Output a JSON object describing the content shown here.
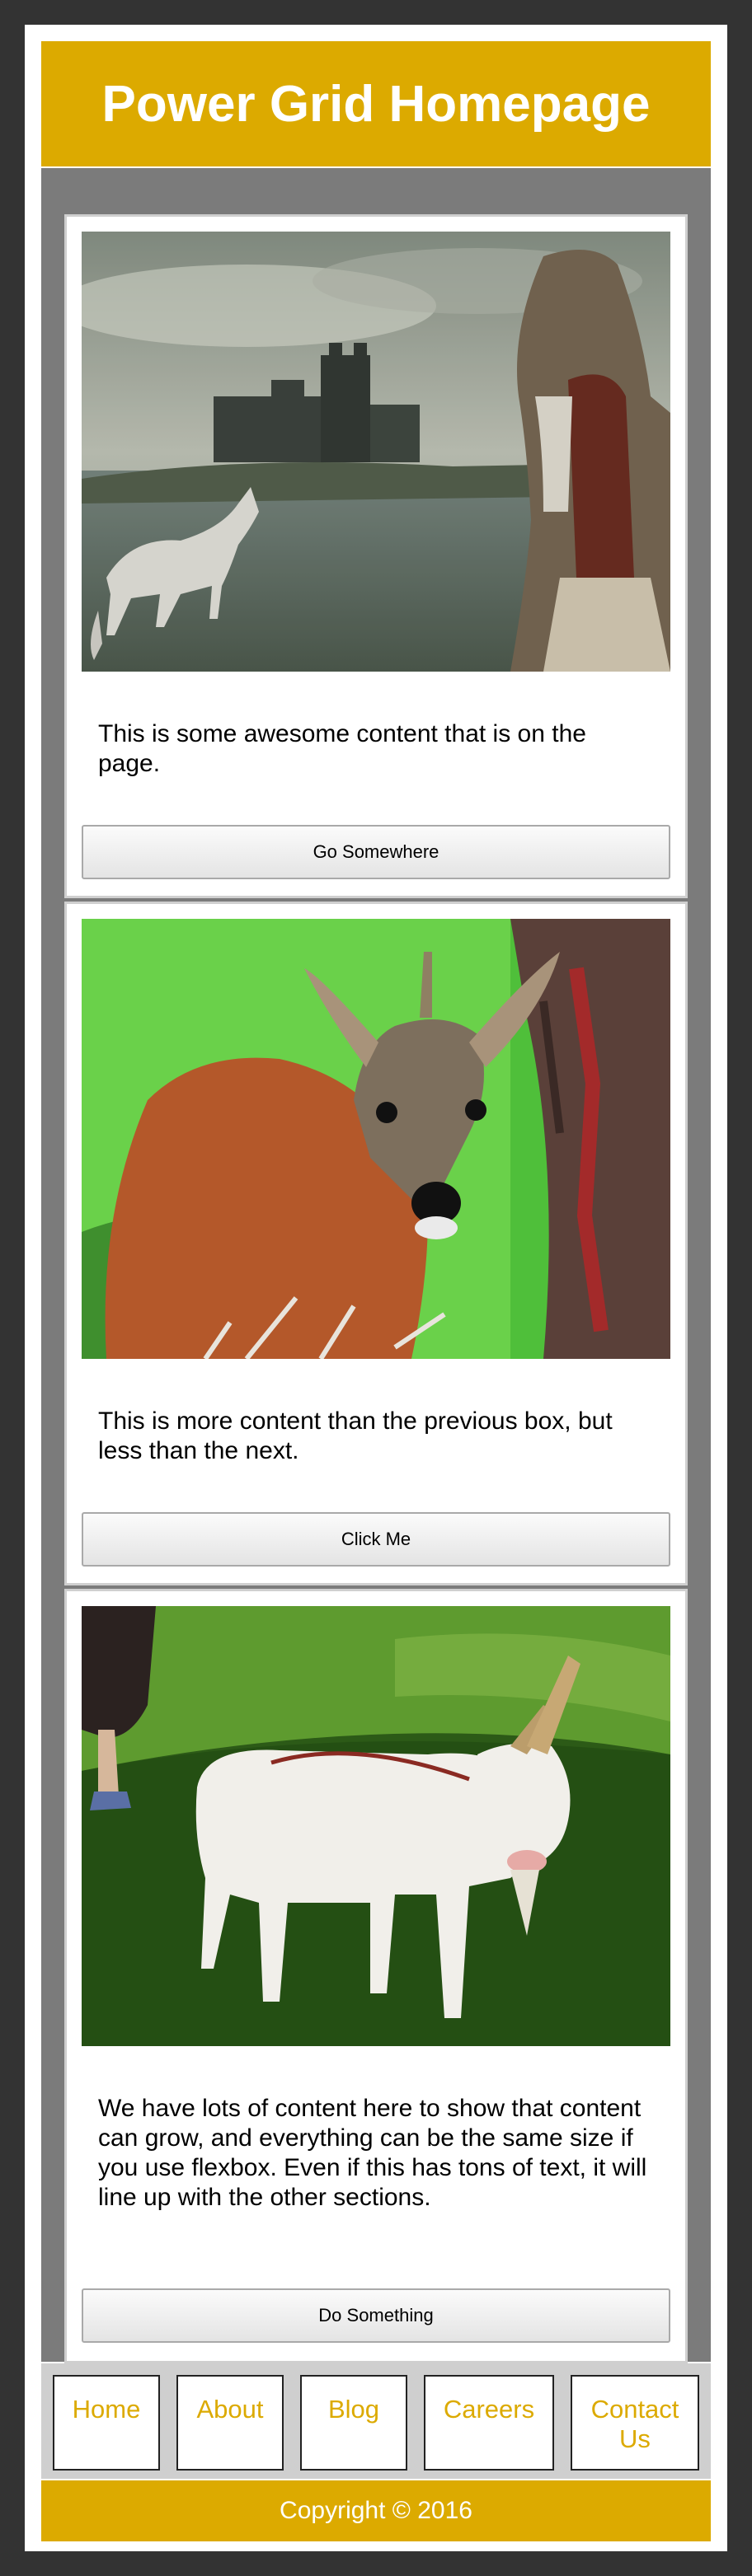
{
  "header": {
    "title": "Power Grid Homepage"
  },
  "cards": [
    {
      "text": "This is some awesome content that is on the page.",
      "button": "Go Somewhere",
      "image": "castle-unicorn-woman-image"
    },
    {
      "text": "This is more content than the previous box, but less than the next.",
      "button": "Click Me",
      "image": "deer-image"
    },
    {
      "text": "We have lots of content here to show that content can grow, and everything can be the same size if you use flexbox. Even if this has tons of text, it will line up with the other sections.",
      "button": "Do Something",
      "image": "goat-image"
    }
  ],
  "nav": [
    {
      "label": "Home"
    },
    {
      "label": "About"
    },
    {
      "label": "Blog"
    },
    {
      "label": "Careers"
    },
    {
      "label": "Contact Us"
    }
  ],
  "footer": {
    "copyright": "Copyright © 2016"
  },
  "colors": {
    "brand": "#dcaa00",
    "background": "#333333",
    "content_bg": "#7b7b7b"
  }
}
